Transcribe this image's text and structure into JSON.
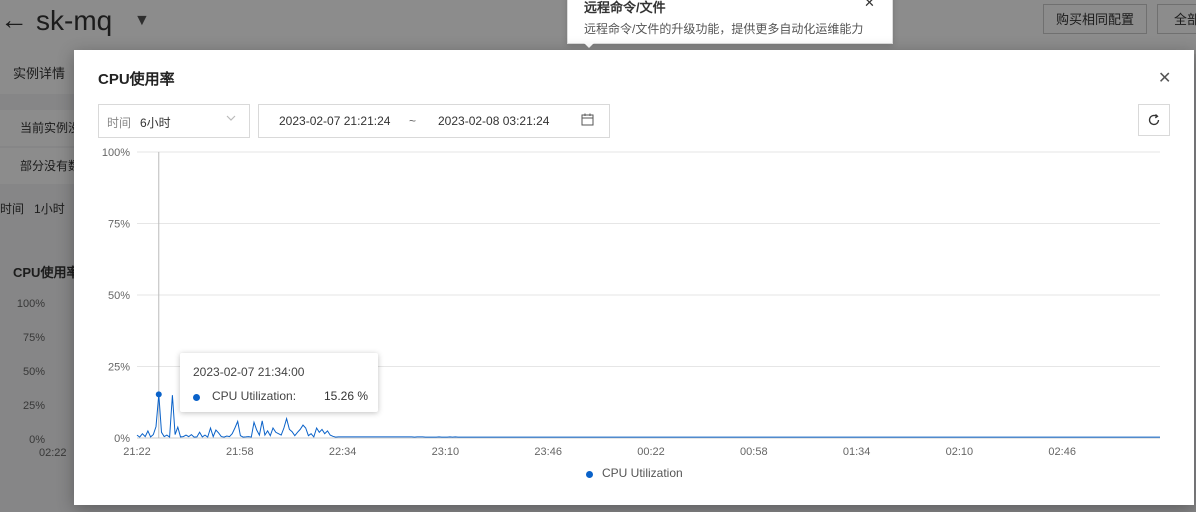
{
  "background": {
    "back_icon": "arrow-left-icon",
    "instance_name": "sk-mq",
    "caret_icon": "caret-down-icon",
    "buttons": [
      "购买相同配置",
      "全部"
    ],
    "tab": "实例详情",
    "notice_lines": [
      "当前实例没",
      "部分没有数"
    ],
    "time_label": "时间",
    "time_value": "1小时",
    "cpu_title": "CPU使用率",
    "y_ticks": [
      "100%",
      "75%",
      "50%",
      "25%",
      "0%"
    ],
    "x_tick": "02:22"
  },
  "notice_popover": {
    "title": "远程命令/文件",
    "description": "远程命令/文件的升级功能，提供更多自动化运维能力",
    "close_icon": "close-icon"
  },
  "modal": {
    "title": "CPU使用率",
    "close_icon": "close-icon",
    "period": {
      "label": "时间",
      "value": "6小时",
      "arrow_icon": "chevron-down-icon"
    },
    "range": {
      "start": "2023-02-07 21:21:24",
      "separator": "~",
      "end": "2023-02-08 03:21:24",
      "calendar_icon": "calendar-icon"
    },
    "refresh_icon": "refresh-icon",
    "tooltip": {
      "time": "2023-02-07 21:34:00",
      "series": "CPU Utilization:",
      "value": "15.26 %"
    },
    "legend": "CPU Utilization"
  },
  "chart_data": {
    "type": "line",
    "series": [
      {
        "name": "CPU Utilization",
        "color": "#0a62c9",
        "values": [
          1.0,
          0.3,
          1.5,
          0.5,
          2.5,
          0.4,
          1.2,
          4.0,
          15.26,
          2.0,
          0.5,
          1.0,
          0.3,
          15.0,
          1.2,
          3.8,
          0.4,
          0.5,
          1.0,
          0.5,
          1.2,
          0.3,
          0.4,
          2.0,
          0.4,
          1.0,
          0.3,
          3.5,
          0.5,
          2.8,
          1.8,
          0.5,
          0.3,
          0.7,
          0.5,
          1.5,
          3.5,
          5.8,
          0.8,
          0.3,
          0.4,
          0.5,
          0.3,
          5.5,
          2.8,
          1.0,
          6.0,
          1.0,
          2.5,
          0.8,
          3.5,
          2.0,
          1.5,
          1.0,
          3.5,
          6.8,
          3.0,
          2.2,
          0.8,
          2.0,
          3.0,
          4.5,
          3.5,
          0.8,
          1.5,
          0.4,
          3.5,
          2.0,
          3.0,
          1.5,
          2.5,
          1.0,
          0.6,
          0.3,
          0.4,
          0.4,
          0.4,
          0.4,
          0.4,
          0.4,
          0.4,
          0.4,
          0.4,
          0.4,
          0.4,
          0.4,
          0.4,
          0.4,
          0.4,
          0.4,
          0.4,
          0.4,
          0.4,
          0.4,
          0.4,
          0.4,
          0.4,
          0.4,
          0.4,
          0.4,
          0.4,
          0.4,
          0.3,
          0.4,
          0.4,
          0.4,
          0.3,
          0.3,
          0.3,
          0.3,
          0.3,
          0.4,
          0.3,
          0.3,
          0.3,
          0.4,
          0.3,
          0.4,
          0.3,
          0.3,
          0.3,
          0.3,
          0.3,
          0.3,
          0.3,
          0.3,
          0.3,
          0.3,
          0.3,
          0.3,
          0.3,
          0.3,
          0.3,
          0.3,
          0.3,
          0.3,
          0.3,
          0.3,
          0.3,
          0.3,
          0.3,
          0.3,
          0.3,
          0.3,
          0.3,
          0.3,
          0.3,
          0.3,
          0.3,
          0.3,
          0.3,
          0.3,
          0.3,
          0.3,
          0.3,
          0.3,
          0.3,
          0.3,
          0.3,
          0.3,
          0.3,
          0.3,
          0.3,
          0.3,
          0.3,
          0.3,
          0.3,
          0.3,
          0.3,
          0.3,
          0.3,
          0.3,
          0.3,
          0.3,
          0.3,
          0.3,
          0.3,
          0.3,
          0.3,
          0.3,
          0.3,
          0.3,
          0.3,
          0.3,
          0.3,
          0.3,
          0.3,
          0.3,
          0.3,
          0.3,
          0.3,
          0.3,
          0.3,
          0.3,
          0.3,
          0.3,
          0.3,
          0.3,
          0.3,
          0.3,
          0.3,
          0.3,
          0.3,
          0.3,
          0.3,
          0.3,
          0.3,
          0.3,
          0.3,
          0.3,
          0.3,
          0.3,
          0.3,
          0.3,
          0.3,
          0.3,
          0.3,
          0.3,
          0.3,
          0.3,
          0.3,
          0.3,
          0.3,
          0.3,
          0.3,
          0.3,
          0.3,
          0.3,
          0.3,
          0.3,
          0.3,
          0.3,
          0.3,
          0.3,
          0.3,
          0.3,
          0.3,
          0.3,
          0.3,
          0.3,
          0.3,
          0.3,
          0.3,
          0.3,
          0.3,
          0.3,
          0.3,
          0.3,
          0.3,
          0.3,
          0.3,
          0.3,
          0.3,
          0.3,
          0.3,
          0.3,
          0.3,
          0.3,
          0.3,
          0.3,
          0.3,
          0.3,
          0.3,
          0.3,
          0.3,
          0.3,
          0.3,
          0.3,
          0.3,
          0.3,
          0.3,
          0.3,
          0.3,
          0.3,
          0.3,
          0.3,
          0.3,
          0.3,
          0.3,
          0.3,
          0.3,
          0.3,
          0.3,
          0.3,
          0.3,
          0.3,
          0.3,
          0.3,
          0.3,
          0.3,
          0.3,
          0.3,
          0.3,
          0.3,
          0.3,
          0.3,
          0.3,
          0.3,
          0.3,
          0.3,
          0.3,
          0.3,
          0.3,
          0.3,
          0.3,
          0.3,
          0.3,
          0.3,
          0.3,
          0.3,
          0.3,
          0.3,
          0.3,
          0.3,
          0.3,
          0.3,
          0.3,
          0.3,
          0.3,
          0.3,
          0.3,
          0.3,
          0.3,
          0.3,
          0.3,
          0.3,
          0.3,
          0.3,
          0.3,
          0.3,
          0.3,
          0.3,
          0.3,
          0.3,
          0.3,
          0.3,
          0.3,
          0.3,
          0.3,
          0.3,
          0.3,
          0.3,
          0.3,
          0.3,
          0.3,
          0.3,
          0.3,
          0.3,
          0.3,
          0.3,
          0.3,
          0.3,
          0.3,
          0.3,
          0.3,
          0.3,
          0.3,
          0.3,
          0.3,
          0.3,
          0.3,
          0.3,
          0.3,
          0.3,
          0.3,
          0.3,
          0.3,
          0.3,
          0.3,
          0.3,
          0.3,
          0.3,
          0.3,
          0.3,
          0.3,
          0.3,
          0.3
        ]
      }
    ],
    "x_ticks": [
      "21:22",
      "21:58",
      "22:34",
      "23:10",
      "23:46",
      "00:22",
      "00:58",
      "01:34",
      "02:10",
      "02:46"
    ],
    "y_ticks": [
      "0%",
      "25%",
      "50%",
      "75%",
      "100%"
    ],
    "ylim": [
      0,
      100
    ],
    "grid": true,
    "legend_position": "bottom"
  }
}
